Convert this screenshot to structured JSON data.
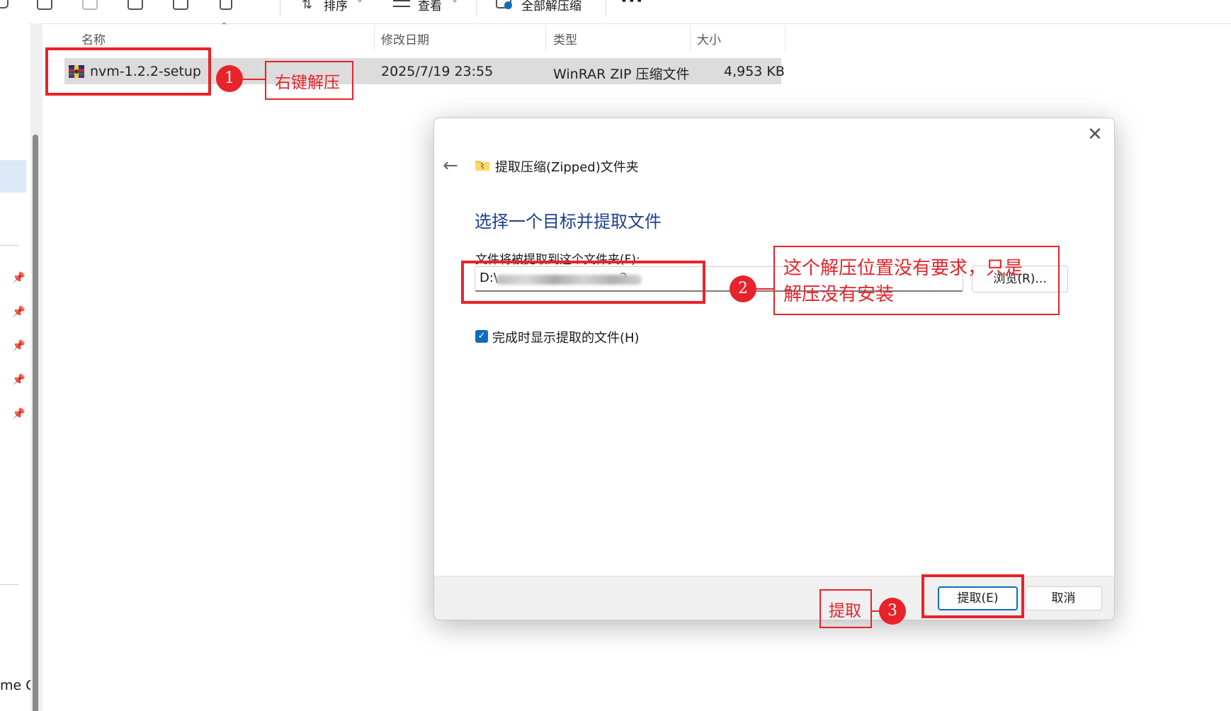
{
  "toolbar": {
    "sort_label": "排序",
    "view_label": "查看",
    "extract_all_label": "全部解压缩",
    "more_label": "···"
  },
  "nav": {
    "partial_label": "me C"
  },
  "columns": {
    "name": "名称",
    "modified": "修改日期",
    "type": "类型",
    "size": "大小"
  },
  "file": {
    "name": "nvm-1.2.2-setup",
    "modified": "2025/7/19 23:55",
    "type": "WinRAR ZIP 压缩文件",
    "size": "4,953 KB"
  },
  "dialog": {
    "title": "提取压缩(Zipped)文件夹",
    "heading": "选择一个目标并提取文件",
    "dest_label": "文件将被提取到这个文件夹(F):",
    "dest_value": "D:\\",
    "dest_value_tail": ".2",
    "browse_label": "浏览(R)...",
    "show_files_label": "完成时显示提取的文件(H)",
    "show_files_checked": true,
    "extract_label": "提取(E)",
    "cancel_label": "取消"
  },
  "annotations": {
    "step1_number": "1",
    "step1_text": "右键解压",
    "step2_number": "2",
    "step2_text_line1": "这个解压位置没有要求，只是",
    "step2_text_line2": "解压没有安装",
    "step3_number": "3",
    "step3_text": "提取"
  },
  "colors": {
    "annotation_red": "#e8232a",
    "accent_blue": "#0f6cbd",
    "heading_blue": "#1f3f90",
    "selection_gray": "#dcdcdc"
  },
  "icons": [
    "copy-icon",
    "paste-icon",
    "share-icon",
    "export-icon",
    "delete-icon",
    "sort-icon",
    "view-icon",
    "extract-all-icon",
    "pin-icon",
    "winrar-icon",
    "zip-folder-icon",
    "back-arrow-icon",
    "close-icon",
    "checkbox-checked-icon"
  ]
}
